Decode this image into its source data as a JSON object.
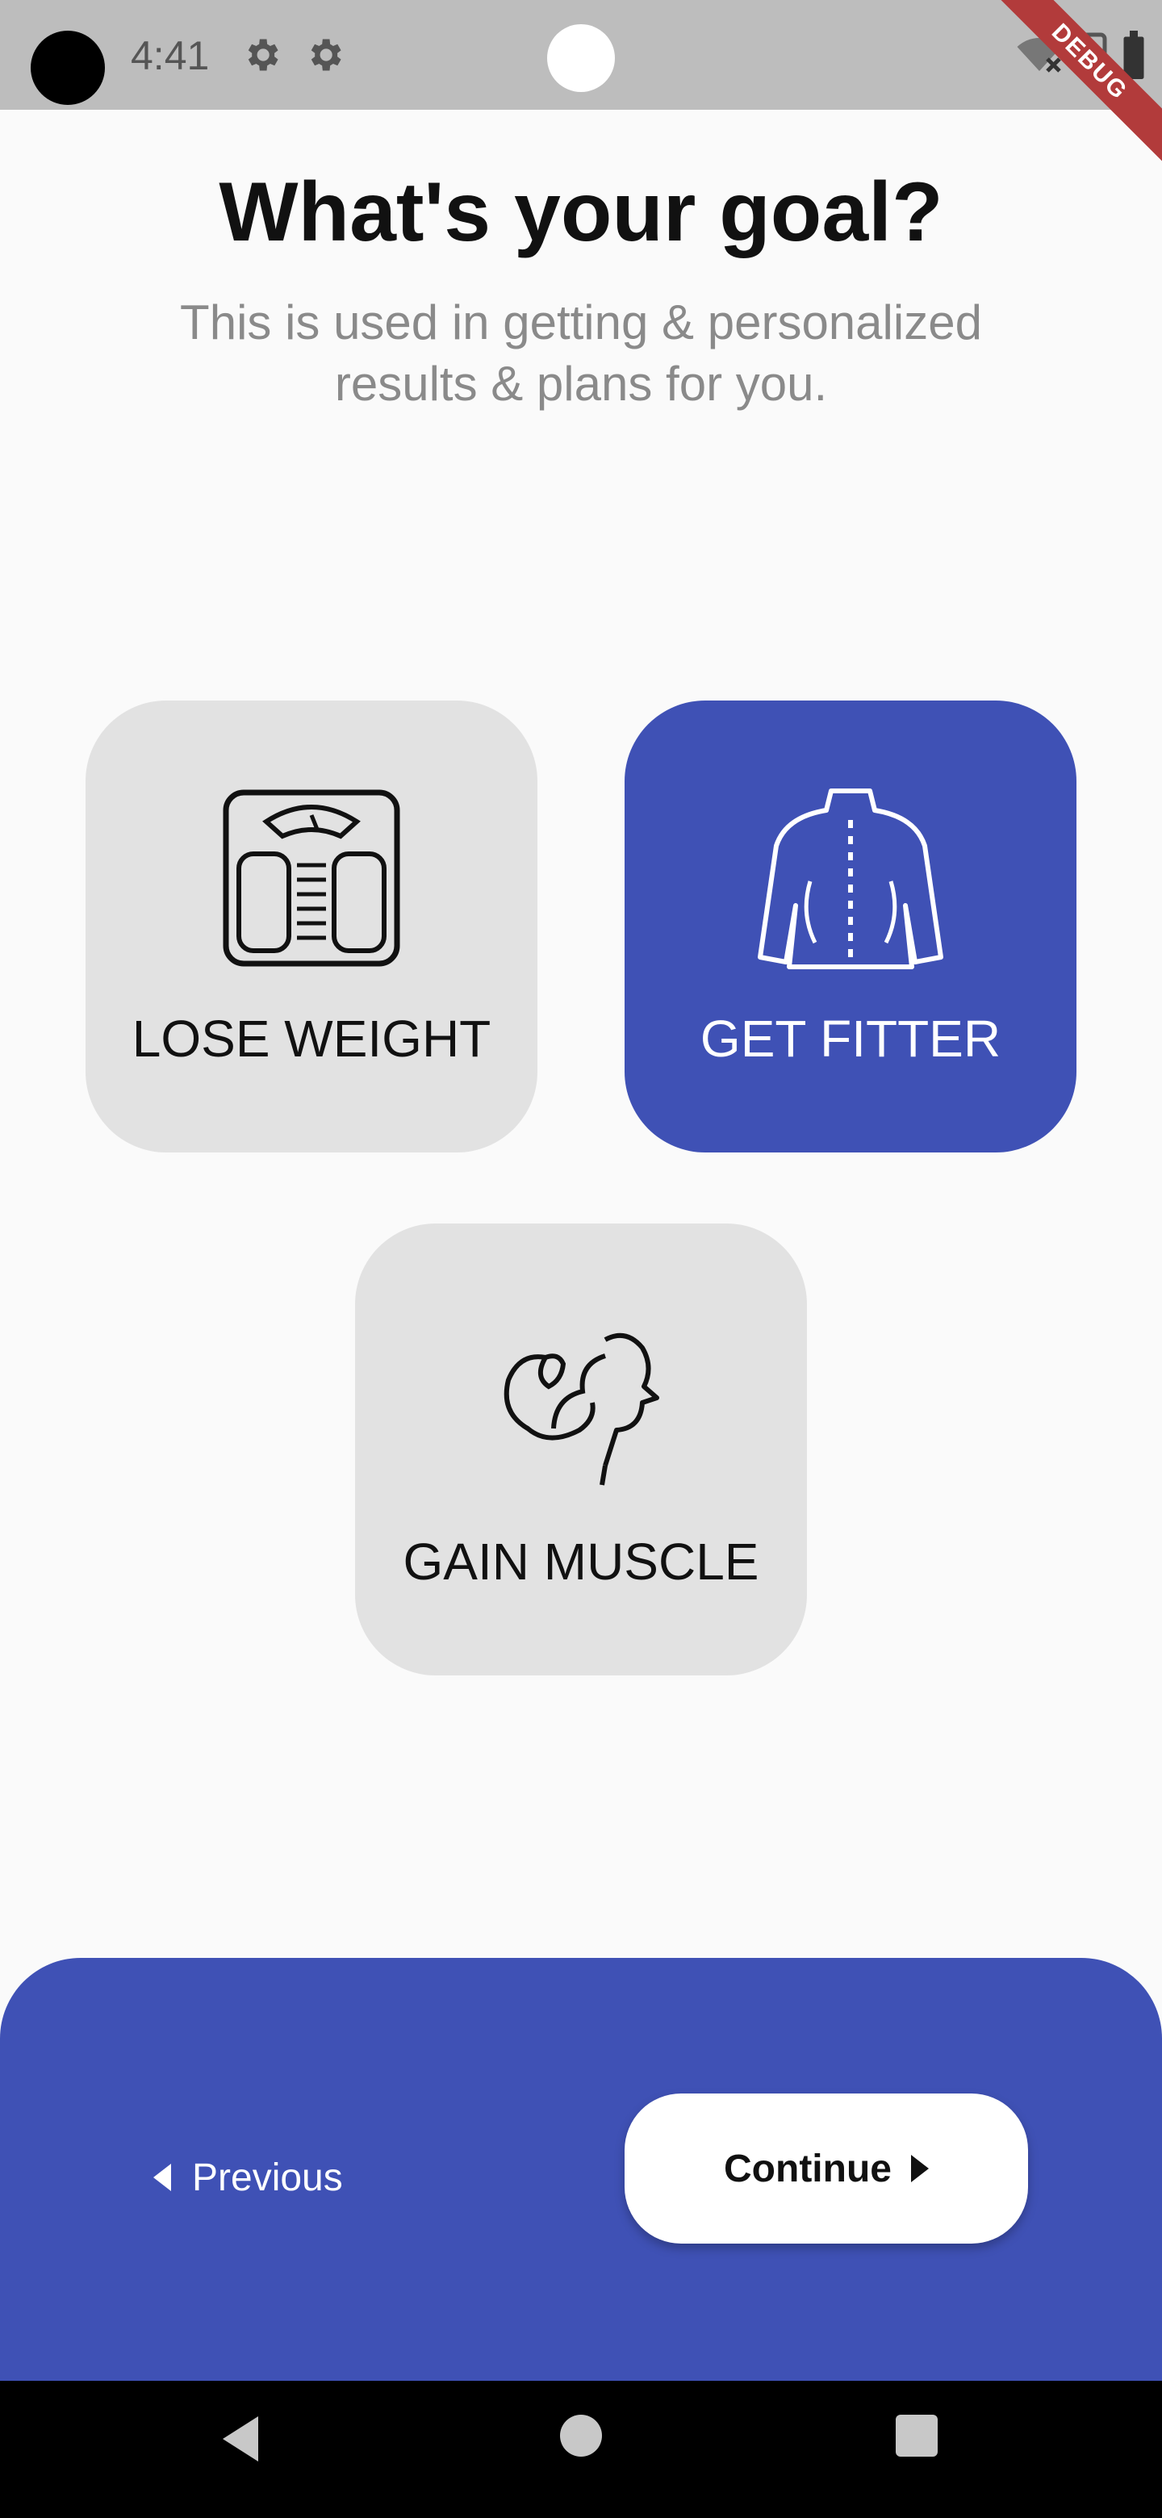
{
  "status": {
    "time": "4:41",
    "debug": "DEBUG"
  },
  "header": {
    "title": "What's your goal?",
    "subtitle": "This is used in getting & personalized results & plans for you."
  },
  "goals": [
    {
      "label": "LOSE WEIGHT",
      "icon": "scale-icon",
      "selected": false
    },
    {
      "label": "GET FITTER",
      "icon": "back-torso-icon",
      "selected": true
    },
    {
      "label": "GAIN MUSCLE",
      "icon": "flexed-arm-icon",
      "selected": false
    }
  ],
  "footer": {
    "previous_label": "Previous",
    "continue_label": "Continue"
  },
  "colors": {
    "accent": "#3f51b5",
    "card": "#e2e2e2",
    "background": "#fafafa"
  }
}
